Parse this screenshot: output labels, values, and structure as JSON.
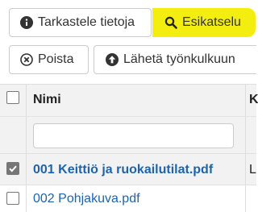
{
  "toolbar": {
    "info_label": "Tarkastele tietoja",
    "preview_label": "Esikatselu",
    "delete_label": "Poista",
    "send_label": "Lähetä työnkulkuun"
  },
  "table": {
    "columns": [
      "Nimi",
      "K"
    ],
    "rows": [
      {
        "name": "001 Keittiö ja ruokailutilat.pdf",
        "next": "L",
        "selected": true
      },
      {
        "name": "002 Pohjakuva.pdf",
        "next": "",
        "selected": false
      }
    ]
  },
  "colors": {
    "highlight": "#f4ee10",
    "link": "#1c64b0"
  }
}
